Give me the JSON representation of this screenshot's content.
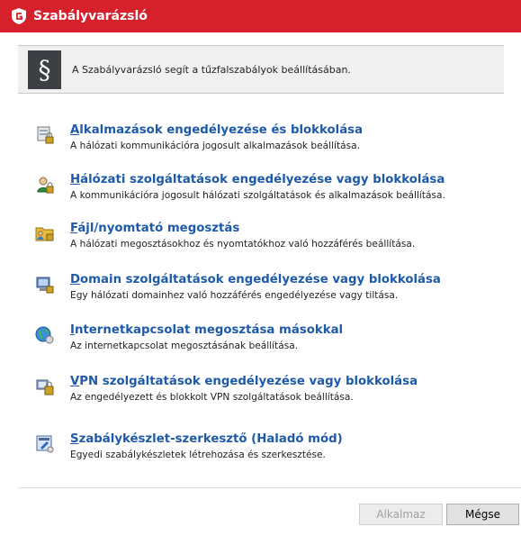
{
  "window": {
    "title": "Szabályvarázsló",
    "accent_color": "#d6212d",
    "logo_icon": "gdata-shield-icon"
  },
  "header": {
    "badge_symbol": "§",
    "text": "A Szabályvarázsló segít a tűzfalszabályok beállításában."
  },
  "options": [
    {
      "icon": "application-lock-icon",
      "label_first": "A",
      "label_rest": "lkalmazások engedélyezése és blokkolása",
      "description": "A hálózati kommunikációra jogosult alkalmazások beállítása."
    },
    {
      "icon": "network-service-lock-icon",
      "label_first": "H",
      "label_rest": "álózati szolgáltatások engedélyezése vagy blokkolása",
      "description": "A kommunikációra jogosult hálózati szolgáltatások és alkalmazások beállítása."
    },
    {
      "icon": "shared-folder-icon",
      "label_first": "F",
      "label_rest": "ájl/nyomtató megosztás",
      "description": "A hálózati megosztásokhoz és nyomtatókhoz való hozzáférés beállítása."
    },
    {
      "icon": "domain-server-lock-icon",
      "label_first": "D",
      "label_rest": "omain szolgáltatások engedélyezése vagy blokkolása",
      "description": "Egy hálózati domainhez való hozzáférés engedélyezése vagy tiltása."
    },
    {
      "icon": "internet-globe-icon",
      "label_first": "I",
      "label_rest": "nternetkapcsolat megosztása másokkal",
      "description": "Az internetkapcsolat megosztásának beállítása."
    },
    {
      "icon": "vpn-lock-icon",
      "label_first": "V",
      "label_rest": "PN szolgáltatások engedélyezése vagy blokkolása",
      "description": "Az engedélyezett és blokkolt VPN szolgáltatások beállítása."
    },
    {
      "icon": "ruleset-editor-icon",
      "label_first": "S",
      "label_rest": "zabálykészlet-szerkesztő (Haladó mód)",
      "description": "Egyedi szabálykészletek létrehozása és szerkesztése."
    }
  ],
  "footer": {
    "apply_label": "Alkalmaz",
    "apply_enabled": false,
    "cancel_label": "Mégse"
  }
}
